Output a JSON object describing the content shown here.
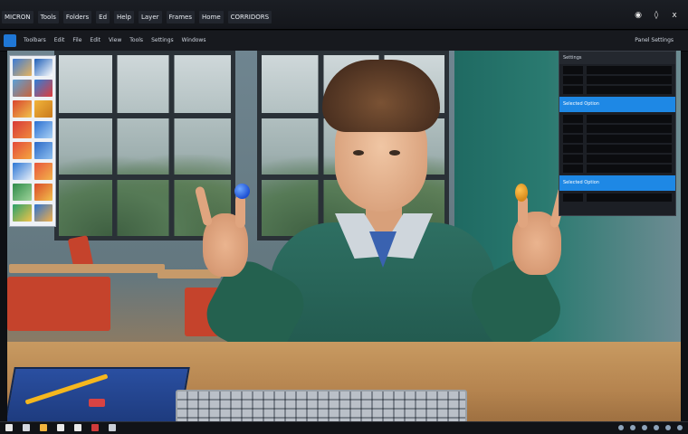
{
  "menu": {
    "items": [
      "MICRON",
      "Tools",
      "Folders",
      "Ed",
      "Help",
      "Layer",
      "Frames",
      "Home",
      "CORRIDORS"
    ]
  },
  "title_controls": {
    "minimize_icon": "minimize-icon",
    "maximize_icon": "maximize-icon",
    "close_label": "x"
  },
  "toolbar": {
    "items": [
      "Toolbars",
      "Edit",
      "File",
      "Edit",
      "View",
      "Tools",
      "Settings",
      "Windows"
    ],
    "right_label": "Panel Settings"
  },
  "right_panel": {
    "header": "Settings",
    "highlight_1": "Selected Option",
    "highlight_2": "Selected Option"
  },
  "colors": {
    "accent": "#1e88e5",
    "jacket": "#2e6f62",
    "panel_bg": "#1c1f25"
  }
}
